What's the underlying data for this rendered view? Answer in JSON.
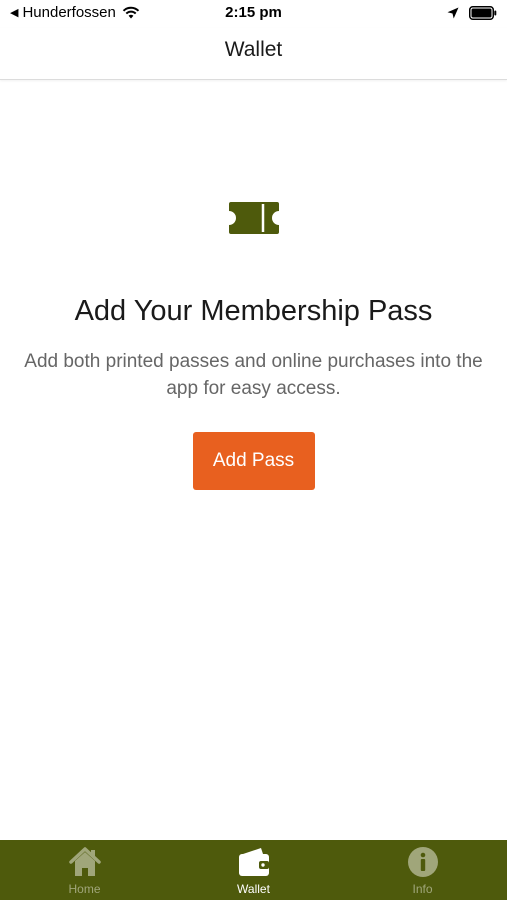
{
  "status_bar": {
    "back_app": "Hunderfossen",
    "time": "2:15 pm"
  },
  "nav": {
    "title": "Wallet"
  },
  "empty_state": {
    "icon": "ticket-icon",
    "title": "Add Your Membership Pass",
    "description": "Add both printed passes and online purchases into the app for easy access.",
    "button_label": "Add Pass"
  },
  "tab_bar": {
    "tabs": [
      {
        "label": "Home",
        "icon": "home-icon",
        "active": false
      },
      {
        "label": "Wallet",
        "icon": "wallet-icon",
        "active": true
      },
      {
        "label": "Info",
        "icon": "info-icon",
        "active": false
      }
    ]
  },
  "colors": {
    "accent": "#e8601f",
    "brand": "#4e5a0c",
    "icon_green": "#4e5a0c"
  }
}
